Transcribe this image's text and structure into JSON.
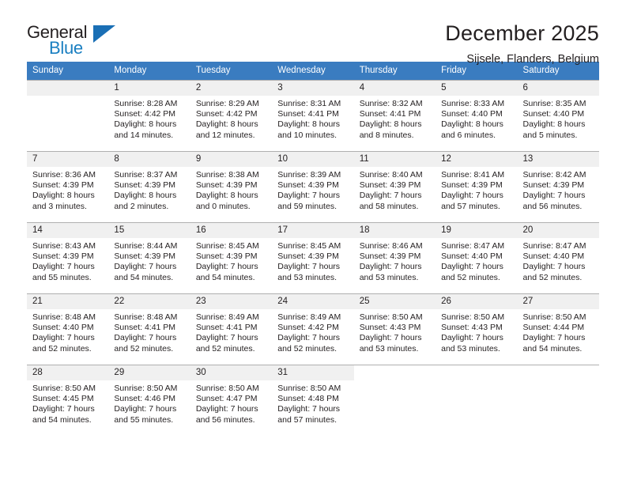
{
  "brand": {
    "name_part1": "General",
    "name_part2": "Blue",
    "triangle_color": "#1a6fb5",
    "blue_color": "#1a7fc1"
  },
  "header": {
    "title": "December 2025",
    "subtitle": "Sijsele, Flanders, Belgium"
  },
  "theme": {
    "header_bg": "#3a7cc0",
    "daynum_bg": "#f0f0f0",
    "grid_line": "#b0b0b0",
    "text": "#231f20"
  },
  "weekday_headers": [
    "Sunday",
    "Monday",
    "Tuesday",
    "Wednesday",
    "Thursday",
    "Friday",
    "Saturday"
  ],
  "weeks": [
    [
      {
        "day": "",
        "sunrise": "",
        "sunset": "",
        "daylight_line1": "",
        "daylight_line2": "",
        "empty": true
      },
      {
        "day": "1",
        "sunrise": "Sunrise: 8:28 AM",
        "sunset": "Sunset: 4:42 PM",
        "daylight_line1": "Daylight: 8 hours",
        "daylight_line2": "and 14 minutes."
      },
      {
        "day": "2",
        "sunrise": "Sunrise: 8:29 AM",
        "sunset": "Sunset: 4:42 PM",
        "daylight_line1": "Daylight: 8 hours",
        "daylight_line2": "and 12 minutes."
      },
      {
        "day": "3",
        "sunrise": "Sunrise: 8:31 AM",
        "sunset": "Sunset: 4:41 PM",
        "daylight_line1": "Daylight: 8 hours",
        "daylight_line2": "and 10 minutes."
      },
      {
        "day": "4",
        "sunrise": "Sunrise: 8:32 AM",
        "sunset": "Sunset: 4:41 PM",
        "daylight_line1": "Daylight: 8 hours",
        "daylight_line2": "and 8 minutes."
      },
      {
        "day": "5",
        "sunrise": "Sunrise: 8:33 AM",
        "sunset": "Sunset: 4:40 PM",
        "daylight_line1": "Daylight: 8 hours",
        "daylight_line2": "and 6 minutes."
      },
      {
        "day": "6",
        "sunrise": "Sunrise: 8:35 AM",
        "sunset": "Sunset: 4:40 PM",
        "daylight_line1": "Daylight: 8 hours",
        "daylight_line2": "and 5 minutes."
      }
    ],
    [
      {
        "day": "7",
        "sunrise": "Sunrise: 8:36 AM",
        "sunset": "Sunset: 4:39 PM",
        "daylight_line1": "Daylight: 8 hours",
        "daylight_line2": "and 3 minutes."
      },
      {
        "day": "8",
        "sunrise": "Sunrise: 8:37 AM",
        "sunset": "Sunset: 4:39 PM",
        "daylight_line1": "Daylight: 8 hours",
        "daylight_line2": "and 2 minutes."
      },
      {
        "day": "9",
        "sunrise": "Sunrise: 8:38 AM",
        "sunset": "Sunset: 4:39 PM",
        "daylight_line1": "Daylight: 8 hours",
        "daylight_line2": "and 0 minutes."
      },
      {
        "day": "10",
        "sunrise": "Sunrise: 8:39 AM",
        "sunset": "Sunset: 4:39 PM",
        "daylight_line1": "Daylight: 7 hours",
        "daylight_line2": "and 59 minutes."
      },
      {
        "day": "11",
        "sunrise": "Sunrise: 8:40 AM",
        "sunset": "Sunset: 4:39 PM",
        "daylight_line1": "Daylight: 7 hours",
        "daylight_line2": "and 58 minutes."
      },
      {
        "day": "12",
        "sunrise": "Sunrise: 8:41 AM",
        "sunset": "Sunset: 4:39 PM",
        "daylight_line1": "Daylight: 7 hours",
        "daylight_line2": "and 57 minutes."
      },
      {
        "day": "13",
        "sunrise": "Sunrise: 8:42 AM",
        "sunset": "Sunset: 4:39 PM",
        "daylight_line1": "Daylight: 7 hours",
        "daylight_line2": "and 56 minutes."
      }
    ],
    [
      {
        "day": "14",
        "sunrise": "Sunrise: 8:43 AM",
        "sunset": "Sunset: 4:39 PM",
        "daylight_line1": "Daylight: 7 hours",
        "daylight_line2": "and 55 minutes."
      },
      {
        "day": "15",
        "sunrise": "Sunrise: 8:44 AM",
        "sunset": "Sunset: 4:39 PM",
        "daylight_line1": "Daylight: 7 hours",
        "daylight_line2": "and 54 minutes."
      },
      {
        "day": "16",
        "sunrise": "Sunrise: 8:45 AM",
        "sunset": "Sunset: 4:39 PM",
        "daylight_line1": "Daylight: 7 hours",
        "daylight_line2": "and 54 minutes."
      },
      {
        "day": "17",
        "sunrise": "Sunrise: 8:45 AM",
        "sunset": "Sunset: 4:39 PM",
        "daylight_line1": "Daylight: 7 hours",
        "daylight_line2": "and 53 minutes."
      },
      {
        "day": "18",
        "sunrise": "Sunrise: 8:46 AM",
        "sunset": "Sunset: 4:39 PM",
        "daylight_line1": "Daylight: 7 hours",
        "daylight_line2": "and 53 minutes."
      },
      {
        "day": "19",
        "sunrise": "Sunrise: 8:47 AM",
        "sunset": "Sunset: 4:40 PM",
        "daylight_line1": "Daylight: 7 hours",
        "daylight_line2": "and 52 minutes."
      },
      {
        "day": "20",
        "sunrise": "Sunrise: 8:47 AM",
        "sunset": "Sunset: 4:40 PM",
        "daylight_line1": "Daylight: 7 hours",
        "daylight_line2": "and 52 minutes."
      }
    ],
    [
      {
        "day": "21",
        "sunrise": "Sunrise: 8:48 AM",
        "sunset": "Sunset: 4:40 PM",
        "daylight_line1": "Daylight: 7 hours",
        "daylight_line2": "and 52 minutes."
      },
      {
        "day": "22",
        "sunrise": "Sunrise: 8:48 AM",
        "sunset": "Sunset: 4:41 PM",
        "daylight_line1": "Daylight: 7 hours",
        "daylight_line2": "and 52 minutes."
      },
      {
        "day": "23",
        "sunrise": "Sunrise: 8:49 AM",
        "sunset": "Sunset: 4:41 PM",
        "daylight_line1": "Daylight: 7 hours",
        "daylight_line2": "and 52 minutes."
      },
      {
        "day": "24",
        "sunrise": "Sunrise: 8:49 AM",
        "sunset": "Sunset: 4:42 PM",
        "daylight_line1": "Daylight: 7 hours",
        "daylight_line2": "and 52 minutes."
      },
      {
        "day": "25",
        "sunrise": "Sunrise: 8:50 AM",
        "sunset": "Sunset: 4:43 PM",
        "daylight_line1": "Daylight: 7 hours",
        "daylight_line2": "and 53 minutes."
      },
      {
        "day": "26",
        "sunrise": "Sunrise: 8:50 AM",
        "sunset": "Sunset: 4:43 PM",
        "daylight_line1": "Daylight: 7 hours",
        "daylight_line2": "and 53 minutes."
      },
      {
        "day": "27",
        "sunrise": "Sunrise: 8:50 AM",
        "sunset": "Sunset: 4:44 PM",
        "daylight_line1": "Daylight: 7 hours",
        "daylight_line2": "and 54 minutes."
      }
    ],
    [
      {
        "day": "28",
        "sunrise": "Sunrise: 8:50 AM",
        "sunset": "Sunset: 4:45 PM",
        "daylight_line1": "Daylight: 7 hours",
        "daylight_line2": "and 54 minutes."
      },
      {
        "day": "29",
        "sunrise": "Sunrise: 8:50 AM",
        "sunset": "Sunset: 4:46 PM",
        "daylight_line1": "Daylight: 7 hours",
        "daylight_line2": "and 55 minutes."
      },
      {
        "day": "30",
        "sunrise": "Sunrise: 8:50 AM",
        "sunset": "Sunset: 4:47 PM",
        "daylight_line1": "Daylight: 7 hours",
        "daylight_line2": "and 56 minutes."
      },
      {
        "day": "31",
        "sunrise": "Sunrise: 8:50 AM",
        "sunset": "Sunset: 4:48 PM",
        "daylight_line1": "Daylight: 7 hours",
        "daylight_line2": "and 57 minutes."
      },
      {
        "day": "",
        "sunrise": "",
        "sunset": "",
        "daylight_line1": "",
        "daylight_line2": "",
        "empty": true,
        "blank": true
      },
      {
        "day": "",
        "sunrise": "",
        "sunset": "",
        "daylight_line1": "",
        "daylight_line2": "",
        "empty": true,
        "blank": true
      },
      {
        "day": "",
        "sunrise": "",
        "sunset": "",
        "daylight_line1": "",
        "daylight_line2": "",
        "empty": true,
        "blank": true
      }
    ]
  ]
}
